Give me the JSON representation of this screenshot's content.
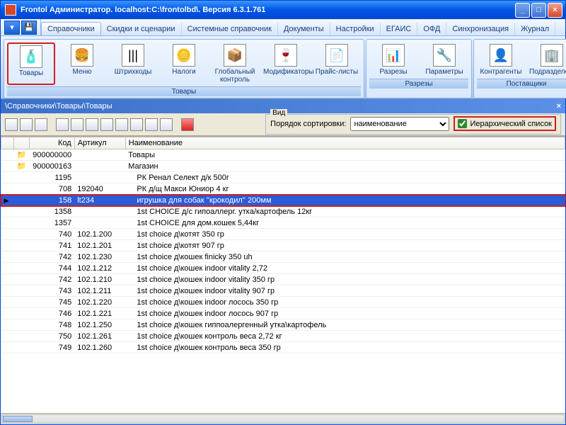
{
  "title": "Frontol Администратор. localhost:C:\\frontolbd\\. Версия 6.3.1.761",
  "menutabs": [
    "Справочники",
    "Скидки и сценарии",
    "Системные справочник",
    "Документы",
    "Настройки",
    "ЕГАИС",
    "ОФД",
    "Синхронизация",
    "Журнал"
  ],
  "ribbon": {
    "g1": {
      "title": "Товары",
      "items": [
        {
          "l": "Товары",
          "i": "🧴"
        },
        {
          "l": "Меню",
          "i": "🍔"
        },
        {
          "l": "Штрихкоды",
          "i": "|||"
        },
        {
          "l": "Налоги",
          "i": "🪙"
        },
        {
          "l": "Глобальный контроль",
          "i": "📦"
        },
        {
          "l": "Модификаторы",
          "i": "🍷"
        },
        {
          "l": "Прайс-листы",
          "i": "📄"
        }
      ]
    },
    "g2": {
      "title": "Разрезы",
      "items": [
        {
          "l": "Разрезы",
          "i": "📊"
        },
        {
          "l": "Параметры",
          "i": "🔧"
        }
      ]
    },
    "g3": {
      "title": "Поставщики",
      "items": [
        {
          "l": "Контрагенты",
          "i": "👤"
        },
        {
          "l": "Подразделения",
          "i": "🏢"
        }
      ]
    }
  },
  "path": "\\Справочники\\Товары\\Товары",
  "vid": {
    "label": "Вид",
    "sortlbl": "Порядок сортировки:",
    "sortval": "наименование",
    "hier": "Иерархический список"
  },
  "cols": {
    "code": "Код",
    "art": "Артикул",
    "name": "Наименование"
  },
  "rows": [
    {
      "f": 1,
      "code": "900000000",
      "art": "",
      "name": "Товары"
    },
    {
      "f": 1,
      "code": "900000163",
      "art": "",
      "name": "Магазин"
    },
    {
      "f": 0,
      "code": "1195",
      "art": "",
      "name": "РК Ренал Селект д/к 500г"
    },
    {
      "f": 0,
      "code": "708",
      "art": "192040",
      "name": "РК д/щ Макси Юниор 4 кг"
    },
    {
      "f": 0,
      "sel": 1,
      "code": "158",
      "art": "lt234",
      "name": "игрушка для собак ''крокодил'' 200мм"
    },
    {
      "f": 0,
      "code": "1358",
      "art": "",
      "name": "1st CHOICE д/с гипоаллерг. утка/картофель 12кг"
    },
    {
      "f": 0,
      "code": "1357",
      "art": "",
      "name": "1st CHOICE для дом.кошек 5,44кг"
    },
    {
      "f": 0,
      "code": "740",
      "art": "102.1.200",
      "name": "1st choice д\\котят 350 гр"
    },
    {
      "f": 0,
      "code": "741",
      "art": "102.1.201",
      "name": "1st choice д\\котят 907 гр"
    },
    {
      "f": 0,
      "code": "742",
      "art": "102.1.230",
      "name": "1st choice д\\кошек finicky 350 uh"
    },
    {
      "f": 0,
      "code": "744",
      "art": "102.1.212",
      "name": "1st choice д\\кошек indoor vitality 2,72"
    },
    {
      "f": 0,
      "code": "742",
      "art": "102.1.210",
      "name": "1st choice д\\кошек indoor vitality 350 гр"
    },
    {
      "f": 0,
      "code": "743",
      "art": "102.1.211",
      "name": "1st choice д\\кошек indoor vitality 907 гр"
    },
    {
      "f": 0,
      "code": "745",
      "art": "102.1.220",
      "name": "1st choice д\\кошек indoor лосось 350 гр"
    },
    {
      "f": 0,
      "code": "746",
      "art": "102.1.221",
      "name": "1st choice д\\кошек indoor лосось 907 гр"
    },
    {
      "f": 0,
      "code": "748",
      "art": "102.1.250",
      "name": "1st choice д\\кошек гиппоалергенный утка\\картофель"
    },
    {
      "f": 0,
      "code": "750",
      "art": "102.1.261",
      "name": "1st choice д\\кошек контроль веса 2,72 кг"
    },
    {
      "f": 0,
      "code": "749",
      "art": "102.1.260",
      "name": "1st choice д\\кошек контроль веса 350 гр"
    }
  ]
}
